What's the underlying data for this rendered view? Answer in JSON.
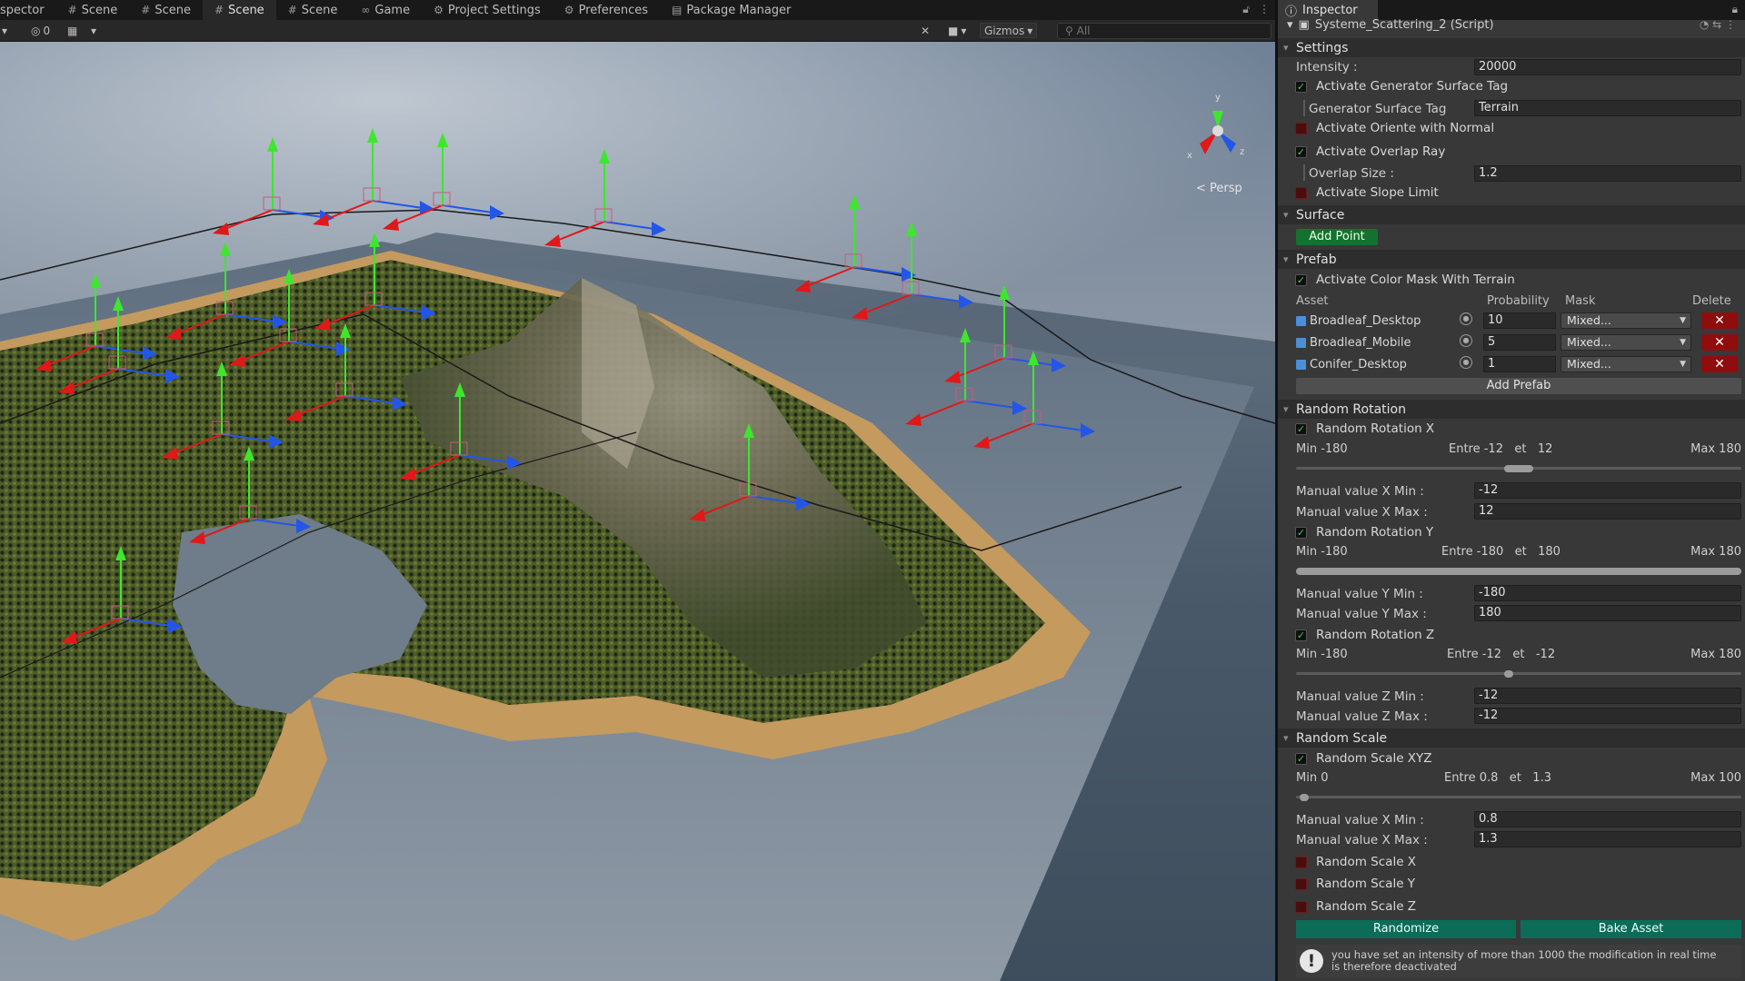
{
  "scene_tabs": {
    "inspector_partial": "spector",
    "tabs": [
      {
        "icon": "#",
        "label": "Scene"
      },
      {
        "icon": "#",
        "label": "Scene"
      },
      {
        "icon": "#",
        "label": "Scene"
      },
      {
        "icon": "#",
        "label": "Scene"
      },
      {
        "icon": "∞",
        "label": "Game"
      },
      {
        "icon": "⚙",
        "label": "Project Settings"
      },
      {
        "icon": "⚙",
        "label": "Preferences"
      },
      {
        "icon": "▤",
        "label": "Package Manager"
      }
    ],
    "active_index": 2
  },
  "toolbar": {
    "visibility_count": "0",
    "gizmos_label": "Gizmos",
    "search_placeholder": "All"
  },
  "scene_view": {
    "projection_label": "< Persp",
    "axis_labels": {
      "x": "x",
      "y": "y",
      "z": "z"
    }
  },
  "inspector": {
    "tab_label": "Inspector",
    "component_title": "Systeme_Scattering_2 (Script)",
    "settings": {
      "header": "Settings",
      "intensity_label": "Intensity :",
      "intensity_value": "20000",
      "activate_generator_surface_tag": {
        "label": "Activate Generator Surface Tag",
        "checked": true
      },
      "generator_surface_tag_label": "Generator Surface Tag",
      "generator_surface_tag_value": "Terrain",
      "activate_oriente_with_normal": {
        "label": "Activate Oriente with Normal",
        "checked": false
      },
      "activate_overlap_ray": {
        "label": "Activate Overlap Ray",
        "checked": true
      },
      "overlap_size_label": "Overlap Size :",
      "overlap_size_value": "1.2",
      "activate_slope_limit": {
        "label": "Activate Slope Limit",
        "checked": false
      }
    },
    "surface": {
      "header": "Surface",
      "add_point_label": "Add Point"
    },
    "prefab": {
      "header": "Prefab",
      "activate_color_mask": {
        "label": "Activate Color Mask With Terrain",
        "checked": true
      },
      "columns": {
        "asset": "Asset",
        "probability": "Probability",
        "mask": "Mask",
        "delete": "Delete"
      },
      "rows": [
        {
          "name": "Broadleaf_Desktop",
          "probability": "10",
          "mask": "Mixed..."
        },
        {
          "name": "Broadleaf_Mobile",
          "probability": "5",
          "mask": "Mixed..."
        },
        {
          "name": "Conifer_Desktop",
          "probability": "1",
          "mask": "Mixed..."
        }
      ],
      "delete_symbol": "✕",
      "add_prefab_label": "Add Prefab"
    },
    "random_rotation": {
      "header": "Random Rotation",
      "x": {
        "toggle": {
          "label": "Random Rotation X",
          "checked": true
        },
        "min_label": "Min -180",
        "entre": "Entre -12   et   12",
        "max_label": "Max 180",
        "slider_min": -180,
        "slider_max": 180,
        "range_low": -12,
        "range_high": 12,
        "manual_min_label": "Manual value X Min :",
        "manual_min_value": "-12",
        "manual_max_label": "Manual value X Max :",
        "manual_max_value": "12"
      },
      "y": {
        "toggle": {
          "label": "Random Rotation Y",
          "checked": true
        },
        "min_label": "Min -180",
        "entre": "Entre -180   et   180",
        "max_label": "Max 180",
        "slider_min": -180,
        "slider_max": 180,
        "range_low": -180,
        "range_high": 180,
        "manual_min_label": "Manual value Y Min :",
        "manual_min_value": "-180",
        "manual_max_label": "Manual value Y Max :",
        "manual_max_value": "180"
      },
      "z": {
        "toggle": {
          "label": "Random Rotation Z",
          "checked": true
        },
        "min_label": "Min -180",
        "entre": "Entre -12   et   -12",
        "max_label": "Max 180",
        "slider_min": -180,
        "slider_max": 180,
        "range_low": -12,
        "range_high": -12,
        "manual_min_label": "Manual value Z Min :",
        "manual_min_value": "-12",
        "manual_max_label": "Manual value Z Max :",
        "manual_max_value": "-12"
      }
    },
    "random_scale": {
      "header": "Random Scale",
      "xyz": {
        "toggle": {
          "label": "Random Scale XYZ",
          "checked": true
        },
        "min_label": "Min 0",
        "entre": "Entre 0.8   et   1.3",
        "max_label": "Max 100",
        "slider_min": 0,
        "slider_max": 100,
        "range_low": 0.8,
        "range_high": 1.3,
        "manual_min_label": "Manual value X Min :",
        "manual_min_value": "0.8",
        "manual_max_label": "Manual value X Max :",
        "manual_max_value": "1.3"
      },
      "scale_x": {
        "label": "Random Scale X",
        "checked": false
      },
      "scale_y": {
        "label": "Random Scale Y",
        "checked": false
      },
      "scale_z": {
        "label": "Random Scale Z",
        "checked": false
      }
    },
    "randomize_label": "Randomize",
    "bake_asset_label": "Bake Asset",
    "warning_text": "you have set an intensity of more than 1000 the modification in real time is therefore deactivated",
    "colors": {
      "toggle_on": "#3fcf4f",
      "toggle_off": "#4a0d0d",
      "delete_red": "#8f0d0d",
      "add_point_green": "#13722f",
      "action_teal": "#0c6c58",
      "gizmo_x": "#e01818",
      "gizmo_y": "#3ee62e",
      "gizmo_z": "#2356e8"
    }
  }
}
